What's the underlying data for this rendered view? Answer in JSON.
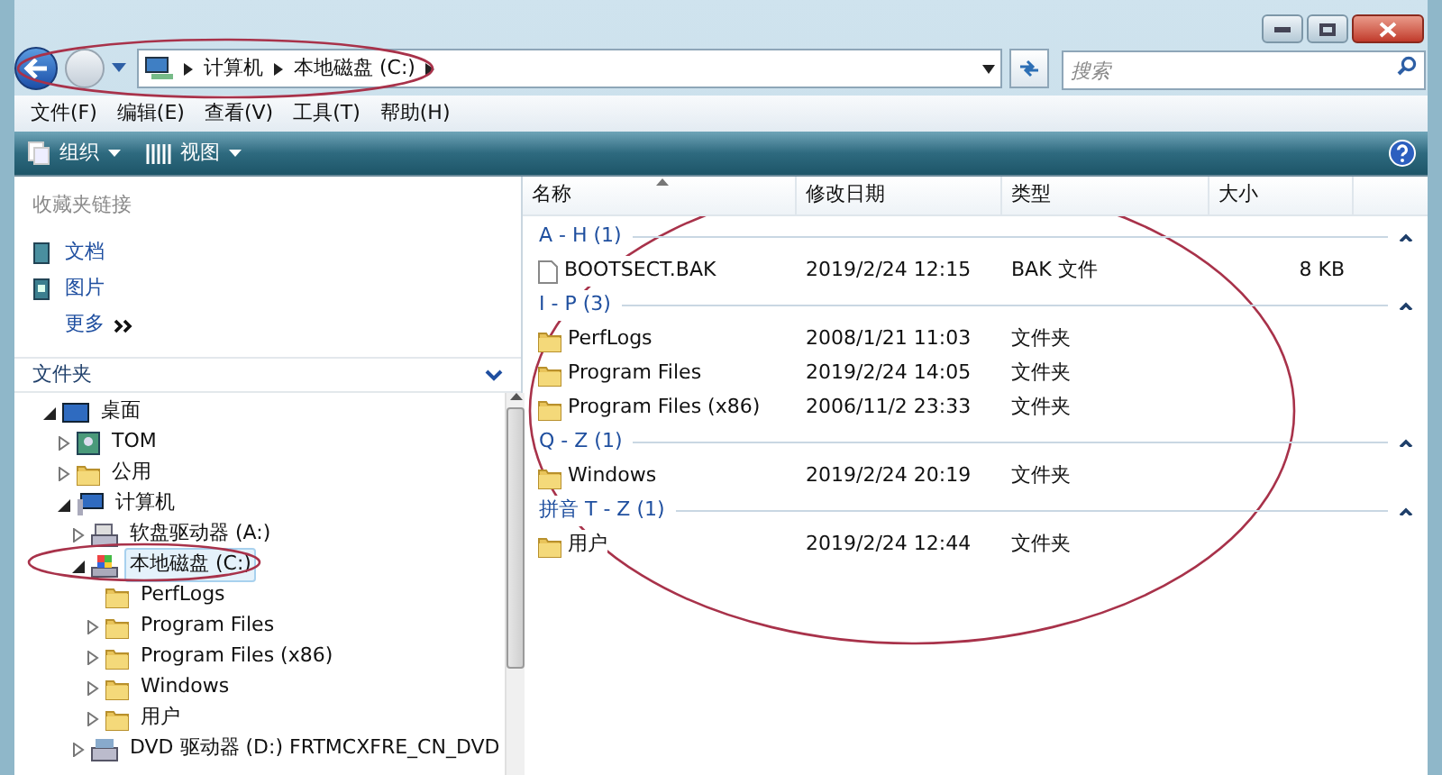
{
  "address_bar": {
    "crumbs": [
      "计算机",
      "本地磁盘 (C:)"
    ]
  },
  "search": {
    "placeholder": "搜索"
  },
  "menu": [
    "文件(F)",
    "编辑(E)",
    "查看(V)",
    "工具(T)",
    "帮助(H)"
  ],
  "toolbar": [
    "组织",
    "视图"
  ],
  "favorites": {
    "title": "收藏夹链接",
    "items": [
      {
        "kind": "docs",
        "label": "文档"
      },
      {
        "kind": "pics",
        "label": "图片"
      },
      {
        "kind": "more",
        "label": "更多"
      }
    ]
  },
  "folders": {
    "title": "文件夹",
    "tree": [
      {
        "label": "桌面",
        "kind": "desktop",
        "expanded": true,
        "selected": false,
        "children": [
          {
            "label": "TOM",
            "kind": "user",
            "expanded": false,
            "selected": false
          },
          {
            "label": "公用",
            "kind": "folder",
            "expanded": false,
            "selected": false
          },
          {
            "label": "计算机",
            "kind": "computer",
            "expanded": true,
            "selected": false,
            "children": [
              {
                "label": "软盘驱动器 (A:)",
                "kind": "floppy",
                "expanded": false,
                "selected": false
              },
              {
                "label": "本地磁盘 (C:)",
                "kind": "drive",
                "expanded": true,
                "selected": true,
                "children": [
                  {
                    "label": "PerfLogs",
                    "kind": "folder",
                    "selected": false
                  },
                  {
                    "label": "Program Files",
                    "kind": "folder",
                    "expanded": false,
                    "selected": false
                  },
                  {
                    "label": "Program Files (x86)",
                    "kind": "folder",
                    "expanded": false,
                    "selected": false
                  },
                  {
                    "label": "Windows",
                    "kind": "folder",
                    "expanded": false,
                    "selected": false
                  },
                  {
                    "label": "用户",
                    "kind": "folder",
                    "expanded": false,
                    "selected": false
                  }
                ]
              },
              {
                "label": "DVD 驱动器 (D:) FRTMCXFRE_CN_DVD",
                "kind": "dvd",
                "expanded": false,
                "selected": false
              }
            ]
          }
        ]
      }
    ]
  },
  "columns": [
    "名称",
    "修改日期",
    "类型",
    "大小"
  ],
  "groups": [
    {
      "label": "A - H (1)",
      "expanded": true,
      "rows": [
        {
          "kind": "file",
          "name": "BOOTSECT.BAK",
          "date": "2019/2/24 12:15",
          "type": "BAK 文件",
          "size": "8 KB"
        }
      ]
    },
    {
      "label": "I - P (3)",
      "expanded": true,
      "rows": [
        {
          "kind": "folder",
          "name": "PerfLogs",
          "date": "2008/1/21 11:03",
          "type": "文件夹"
        },
        {
          "kind": "folder",
          "name": "Program Files",
          "date": "2019/2/24 14:05",
          "type": "文件夹"
        },
        {
          "kind": "folder",
          "name": "Program Files (x86)",
          "date": "2006/11/2 23:33",
          "type": "文件夹"
        }
      ]
    },
    {
      "label": "Q - Z (1)",
      "expanded": true,
      "rows": [
        {
          "kind": "folder",
          "name": "Windows",
          "date": "2019/2/24 20:19",
          "type": "文件夹"
        }
      ]
    },
    {
      "label": "拼音 T - Z (1)",
      "expanded": true,
      "rows": [
        {
          "kind": "folder",
          "name": "用户",
          "date": "2019/2/24 12:44",
          "type": "文件夹"
        }
      ]
    }
  ],
  "annotations": [
    {
      "kind": "ellipse"
    },
    {
      "kind": "ellipse"
    },
    {
      "kind": "ellipse"
    }
  ]
}
